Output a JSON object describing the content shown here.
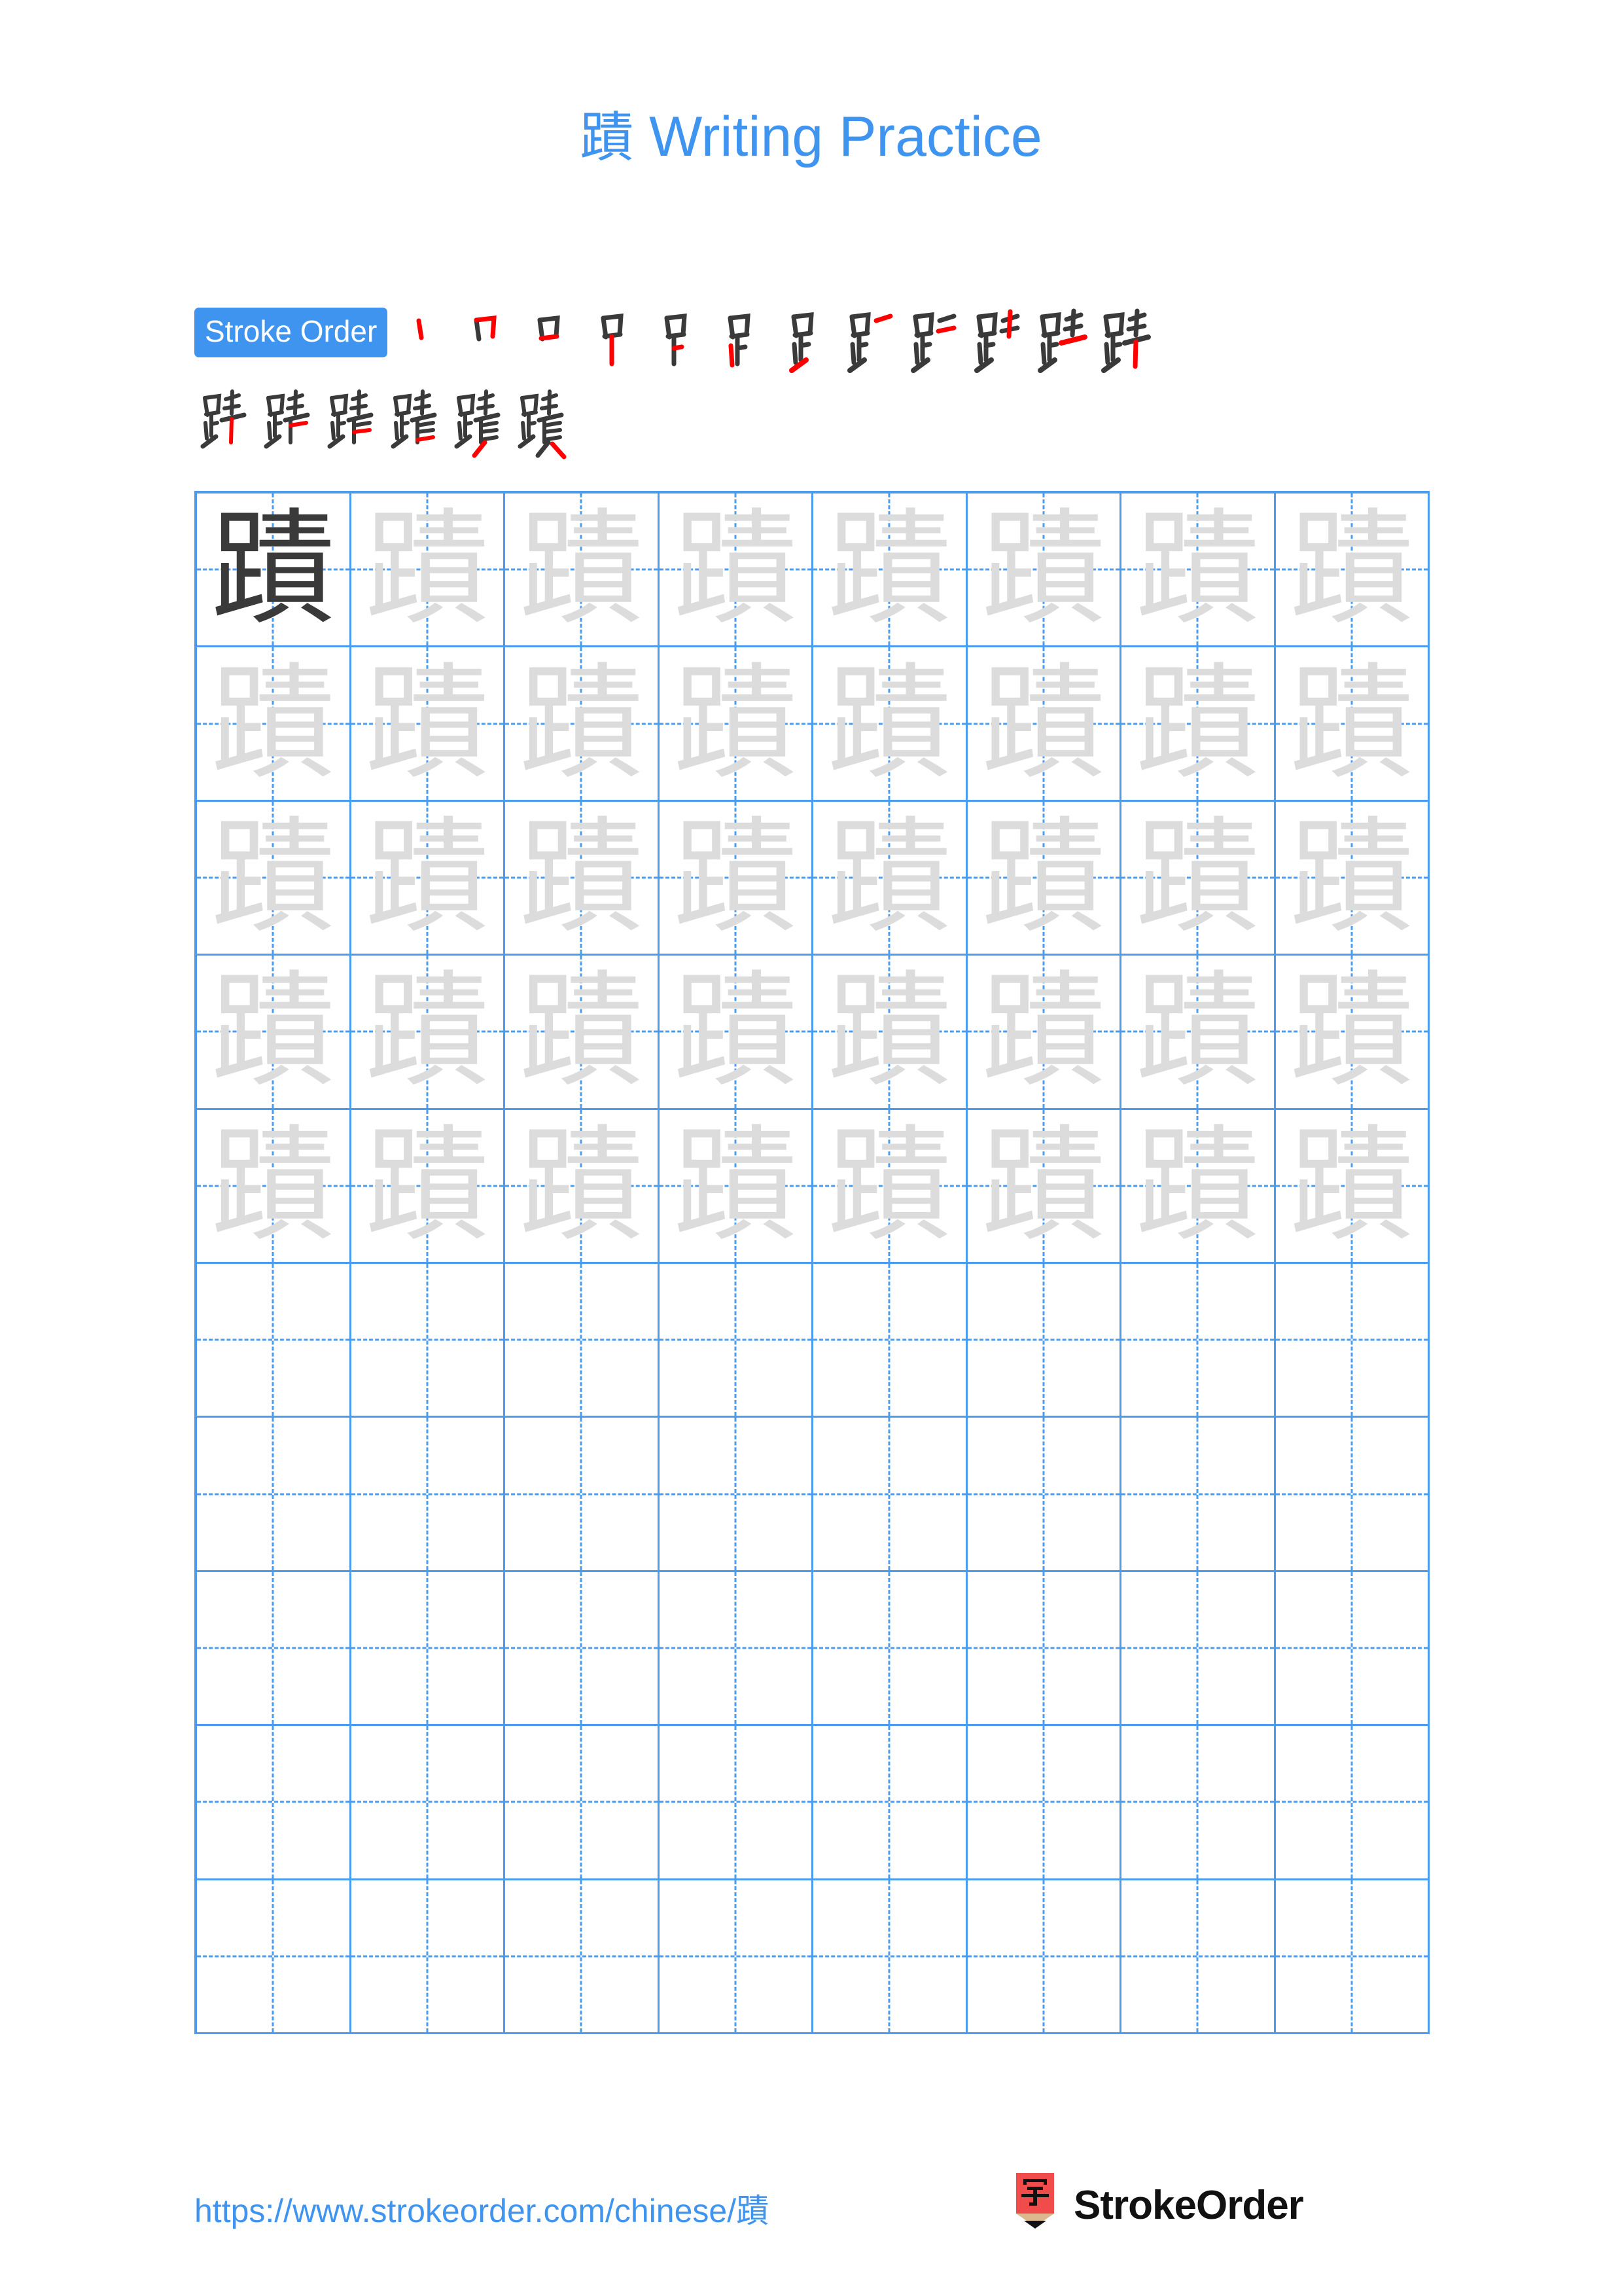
{
  "page": {
    "character": "蹟",
    "title_suffix": " Writing Practice",
    "title_full": "蹟 Writing Practice",
    "accent_color": "#3F94EF",
    "grid_line_color": "#4B9CEF",
    "trace_gray_color": "#DCDCDC",
    "model_dark_color": "#3A3A3A",
    "new_stroke_color": "#FF0000",
    "background_color": "#FFFFFF"
  },
  "stroke_order": {
    "badge_label": "Stroke Order",
    "total_strokes": 18,
    "row1_count": 12,
    "row2_count": 6,
    "steps": [
      {
        "index": 1,
        "glyph": "丨"
      },
      {
        "index": 2,
        "glyph": "冂"
      },
      {
        "index": 3,
        "glyph": "口"
      },
      {
        "index": 4,
        "glyph": "吊"
      },
      {
        "index": 5,
        "glyph": "𧾷"
      },
      {
        "index": 6,
        "glyph": "𧾷"
      },
      {
        "index": 7,
        "glyph": "𧾷"
      },
      {
        "index": 8,
        "glyph": "𧾷一"
      },
      {
        "index": 9,
        "glyph": "𧾷二"
      },
      {
        "index": 10,
        "glyph": "𧾷丰"
      },
      {
        "index": 11,
        "glyph": "跬"
      },
      {
        "index": 12,
        "glyph": "跬"
      },
      {
        "index": 13,
        "glyph": "蹟"
      },
      {
        "index": 14,
        "glyph": "蹟"
      },
      {
        "index": 15,
        "glyph": "蹟"
      },
      {
        "index": 16,
        "glyph": "蹟"
      },
      {
        "index": 17,
        "glyph": "蹟"
      },
      {
        "index": 18,
        "glyph": "蹟"
      }
    ]
  },
  "practice_grid": {
    "columns": 8,
    "rows": 10,
    "model_cell": {
      "row": 1,
      "col": 1
    },
    "filled_rows": 5,
    "empty_rows": 5,
    "cell_character": "蹟"
  },
  "footer": {
    "url": "https://www.strokeorder.com/chinese/蹟",
    "brand_name": "StrokeOrder",
    "logo_character": "字",
    "logo_body_color": "#F04C4C",
    "logo_wood_color": "#DDB78E",
    "logo_tip_color": "#111111"
  }
}
